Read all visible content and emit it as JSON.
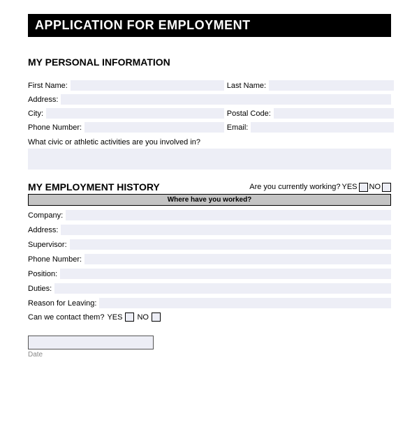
{
  "header": {
    "title": "APPLICATION FOR EMPLOYMENT"
  },
  "personal": {
    "section_title": "MY PERSONAL INFORMATION",
    "first_name_label": "First Name:",
    "last_name_label": "Last Name:",
    "address_label": "Address:",
    "city_label": "City:",
    "postal_label": "Postal Code:",
    "phone_label": "Phone Number:",
    "email_label": "Email:",
    "activities_label": "What civic or athletic activities are you involved in?"
  },
  "history": {
    "section_title": "MY EMPLOYMENT HISTORY",
    "currently_working_label": "Are you currently working?",
    "yes_label": "YES",
    "no_label": "NO",
    "sub_header": "Where have you worked?",
    "company_label": "Company:",
    "address_label": "Address:",
    "supervisor_label": "Supervisor:",
    "phone_label": "Phone Number:",
    "position_label": "Position:",
    "duties_label": "Duties:",
    "reason_label": "Reason for Leaving:",
    "contact_label": "Can we contact them?",
    "contact_yes": "YES",
    "contact_no": "NO"
  },
  "footer": {
    "date_label": "Date"
  }
}
